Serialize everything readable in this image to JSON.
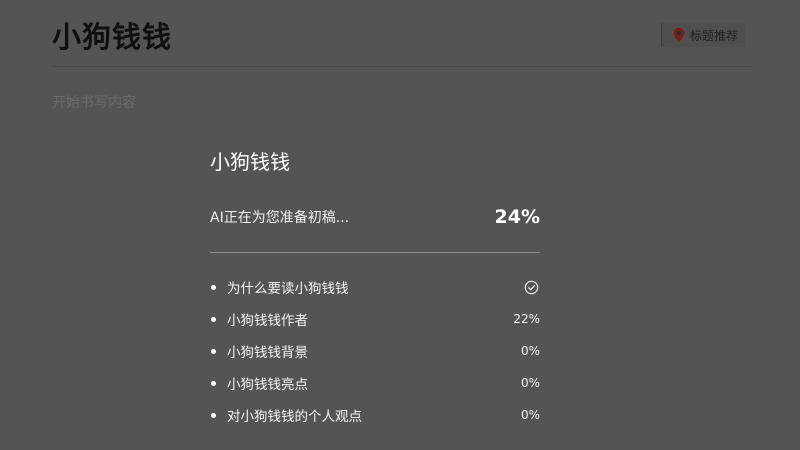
{
  "document": {
    "title": "小狗钱钱",
    "body_placeholder": "开始书写内容"
  },
  "toolbar": {
    "suggest_title_label": "标题推荐",
    "suggest_title_icon": "location-pin-icon"
  },
  "progress_panel": {
    "title": "小狗钱钱",
    "status_text": "AI正在为您准备初稿...",
    "percent": "24%",
    "sections": [
      {
        "label": "为什么要读小狗钱钱",
        "status": "done",
        "icon": "check-circle-icon"
      },
      {
        "label": "小狗钱钱作者",
        "status": "22%"
      },
      {
        "label": "小狗钱钱背景",
        "status": "0%"
      },
      {
        "label": "小狗钱钱亮点",
        "status": "0%"
      },
      {
        "label": "对小狗钱钱的个人观点",
        "status": "0%"
      }
    ]
  },
  "colors": {
    "overlay_background": "#545454",
    "pin_icon": "#c0392b"
  }
}
